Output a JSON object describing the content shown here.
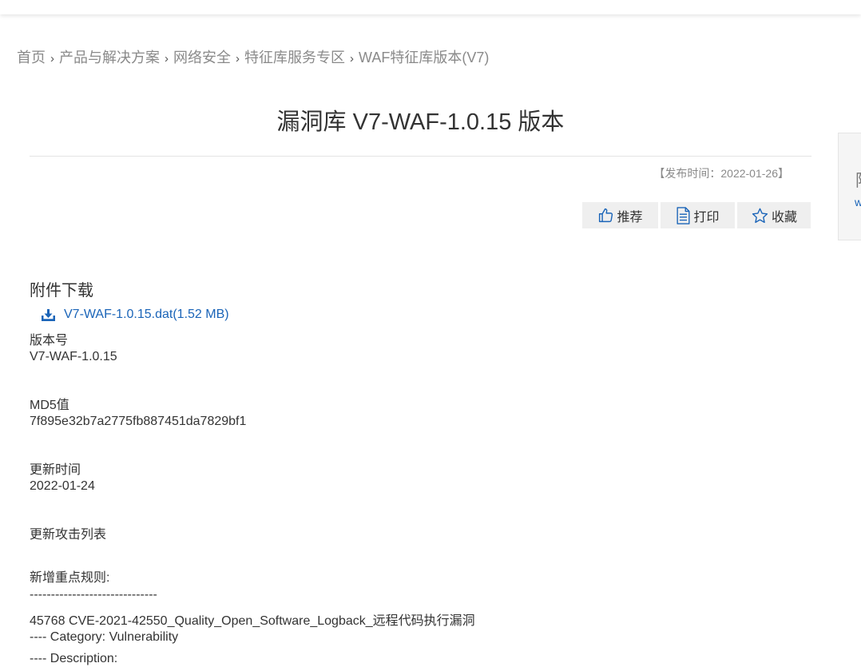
{
  "breadcrumb": [
    "首页",
    "产品与解决方案",
    "网络安全",
    "特征库服务专区",
    "WAF特征库版本(V7)"
  ],
  "breadcrumb_separator": "›",
  "title": "漏洞库 V7-WAF-1.0.15 版本",
  "pubdate": "【发布时间：2022-01-26】",
  "actions": {
    "recommend": "推荐",
    "print": "打印",
    "favorite": "收藏"
  },
  "side": {
    "char": "阿",
    "link": "w"
  },
  "attachments": {
    "title": "附件下载",
    "file": "V7-WAF-1.0.15.dat(1.52 MB)"
  },
  "content": {
    "version_label": "版本号",
    "version_value": "V7-WAF-1.0.15",
    "md5_label": "MD5值",
    "md5_value": "7f895e32b7a2775fb887451da7829bf1",
    "update_time_label": "更新时间",
    "update_time_value": "2022-01-24",
    "attack_list_label": "更新攻击列表",
    "new_rules_label": "新增重点规则:",
    "dashes": "------------------------------",
    "rule_line": "45768 CVE-2021-42550_Quality_Open_Software_Logback_远程代码执行漏洞",
    "category_line": "---- Category: Vulnerability",
    "description_line": "---- Description:"
  },
  "colors": {
    "link": "#1a64b8",
    "muted": "#8a8a8a",
    "text": "#333333",
    "button_bg": "#efefef"
  },
  "icons": [
    "thumbs-up-icon",
    "document-icon",
    "star-icon",
    "download-icon"
  ]
}
